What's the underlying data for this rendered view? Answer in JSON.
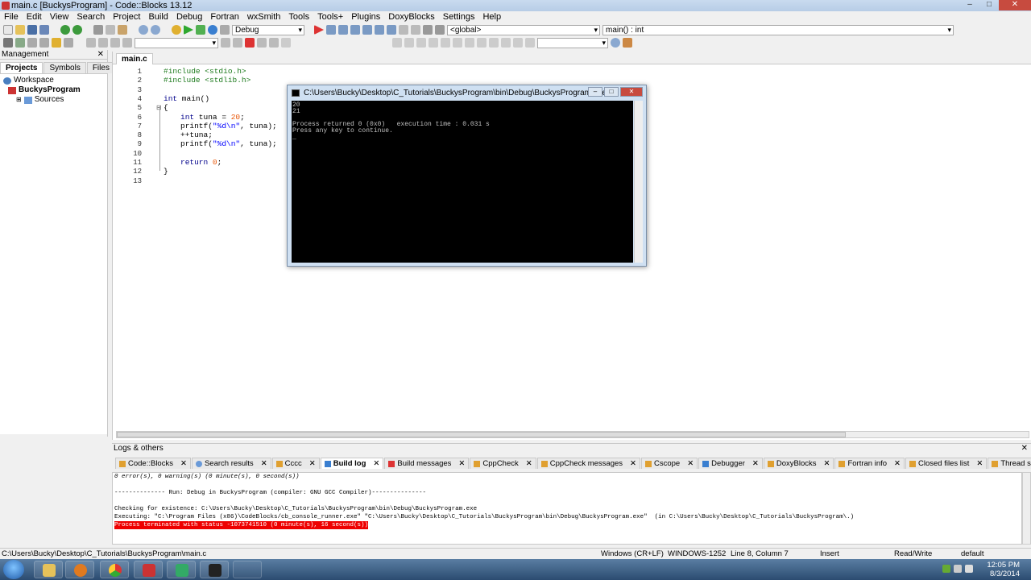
{
  "window": {
    "title": "main.c [BuckysProgram] - Code::Blocks 13.12"
  },
  "menu": [
    "File",
    "Edit",
    "View",
    "Search",
    "Project",
    "Build",
    "Debug",
    "Fortran",
    "wxSmith",
    "Tools",
    "Tools+",
    "Plugins",
    "DoxyBlocks",
    "Settings",
    "Help"
  ],
  "toolbar": {
    "build_target": "Debug",
    "scope": "<global>",
    "function": "main() : int"
  },
  "management": {
    "title": "Management",
    "tabs": [
      "Projects",
      "Symbols",
      "Files"
    ],
    "tree": {
      "workspace": "Workspace",
      "project": "BuckysProgram",
      "folder": "Sources"
    }
  },
  "editor": {
    "tab": "main.c",
    "lines": [
      "1",
      "2",
      "3",
      "4",
      "5",
      "6",
      "7",
      "8",
      "9",
      "10",
      "11",
      "12",
      "13"
    ],
    "code": {
      "l1": "#include <stdio.h>",
      "l2": "#include <stdlib.h>",
      "l4_kw": "int",
      "l4_rest": " main()",
      "l5": "{",
      "l6_kw": "int",
      "l6_a": " tuna = ",
      "l6_num": "20",
      "l6_b": ";",
      "l7_a": "printf(",
      "l7_str": "\"%d\\n\"",
      "l7_b": ", tuna);",
      "l8": "++tuna;",
      "l9_a": "printf(",
      "l9_str": "\"%d\\n\"",
      "l9_b": ", tuna);",
      "l11_kw": "return",
      "l11_num": " 0",
      "l11_b": ";",
      "l12": "}"
    }
  },
  "console": {
    "title": "C:\\Users\\Bucky\\Desktop\\C_Tutorials\\BuckysProgram\\bin\\Debug\\BuckysProgram.exe",
    "output": "20\n21\n\nProcess returned 0 (0x0)   execution time : 0.031 s\nPress any key to continue.\n_"
  },
  "logs": {
    "title": "Logs & others",
    "tabs": [
      "Code::Blocks",
      "Search results",
      "Cccc",
      "Build log",
      "Build messages",
      "CppCheck",
      "CppCheck messages",
      "Cscope",
      "Debugger",
      "DoxyBlocks",
      "Fortran info",
      "Closed files list",
      "Thread search"
    ],
    "active_tab": "Build log",
    "line1": "0 error(s), 0 warning(s) (0 minute(s), 0 second(s))",
    "line2": "-------------- Run: Debug in BuckysProgram (compiler: GNU GCC Compiler)---------------",
    "line3": "Checking for existence: C:\\Users\\Bucky\\Desktop\\C_Tutorials\\BuckysProgram\\bin\\Debug\\BuckysProgram.exe",
    "line4": "Executing: \"C:\\Program Files (x86)\\CodeBlocks/cb_console_runner.exe\" \"C:\\Users\\Bucky\\Desktop\\C_Tutorials\\BuckysProgram\\bin\\Debug\\BuckysProgram.exe\"  (in C:\\Users\\Bucky\\Desktop\\C_Tutorials\\BuckysProgram\\.)",
    "line5": "Process terminated with status -1073741510 (0 minute(s), 16 second(s))"
  },
  "status": {
    "path": "C:\\Users\\Bucky\\Desktop\\C_Tutorials\\BuckysProgram\\main.c",
    "eol": "Windows (CR+LF)",
    "encoding": "WINDOWS-1252",
    "position": "Line 8, Column 7",
    "mode": "Insert",
    "access": "Read/Write",
    "theme": "default"
  },
  "taskbar": {
    "time": "12:05 PM",
    "date": "8/3/2014"
  }
}
